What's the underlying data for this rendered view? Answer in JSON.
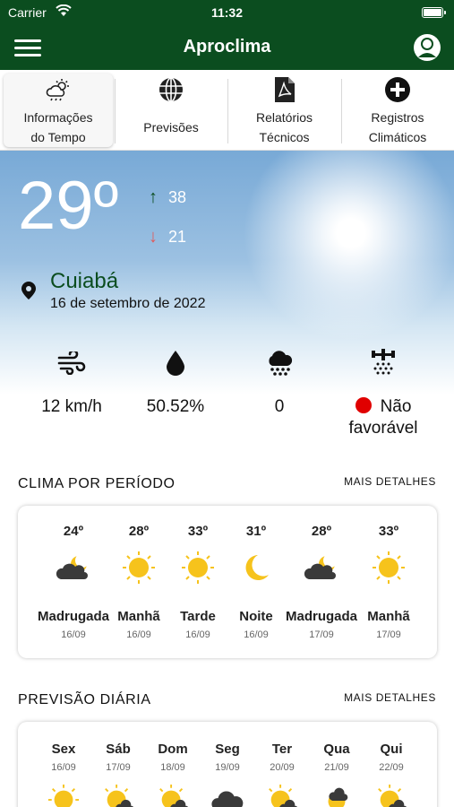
{
  "status_bar": {
    "carrier": "Carrier",
    "time": "11:32"
  },
  "nav": {
    "title": "Aproclima"
  },
  "tabs": [
    {
      "label": "Informações\ndo Tempo",
      "icon": "cloud-sun-icon"
    },
    {
      "label": "Previsões",
      "icon": "globe-icon"
    },
    {
      "label": "Relatórios\nTécnicos",
      "icon": "pdf-file-icon"
    },
    {
      "label": "Registros\nClimáticos",
      "icon": "plus-circle-icon"
    }
  ],
  "current": {
    "temperature": "29º",
    "max": "38",
    "min": "21",
    "city": "Cuiabá",
    "date": "16 de setembro de 2022"
  },
  "metrics": [
    {
      "icon": "wind-icon",
      "value": "12 km/h"
    },
    {
      "icon": "humidity-drop-icon",
      "value": "50.52%"
    },
    {
      "icon": "rain-cloud-icon",
      "value": "0"
    },
    {
      "icon": "sprayer-icon",
      "value_line1": "Não",
      "value_line2": "favorável",
      "status_color": "#e00000"
    }
  ],
  "period_section": {
    "title": "CLIMA POR PERÍODO",
    "link": "MAIS DETALHES"
  },
  "periods": [
    {
      "temp": "24º",
      "label": "Madrugada",
      "date": "16/09",
      "icon": "cloudy-night-icon"
    },
    {
      "temp": "28º",
      "label": "Manhã",
      "date": "16/09",
      "icon": "sun-icon"
    },
    {
      "temp": "33º",
      "label": "Tarde",
      "date": "16/09",
      "icon": "sun-icon"
    },
    {
      "temp": "31º",
      "label": "Noite",
      "date": "16/09",
      "icon": "moon-icon"
    },
    {
      "temp": "28º",
      "label": "Madrugada",
      "date": "17/09",
      "icon": "cloudy-night-icon"
    },
    {
      "temp": "33º",
      "label": "Manhã",
      "date": "17/09",
      "icon": "sun-icon"
    }
  ],
  "daily_section": {
    "title": "PREVISÃO DIÁRIA",
    "link": "MAIS DETALHES"
  },
  "daily": [
    {
      "day": "Sex",
      "date": "16/09",
      "icon": "sun-icon"
    },
    {
      "day": "Sáb",
      "date": "17/09",
      "icon": "partly-cloudy-icon"
    },
    {
      "day": "Dom",
      "date": "18/09",
      "icon": "partly-cloudy-icon"
    },
    {
      "day": "Seg",
      "date": "19/09",
      "icon": "cloud-icon"
    },
    {
      "day": "Ter",
      "date": "20/09",
      "icon": "partly-cloudy-icon"
    },
    {
      "day": "Qua",
      "date": "21/09",
      "icon": "partly-cloudy-icon"
    },
    {
      "day": "Qui",
      "date": "22/09",
      "icon": "partly-cloudy-icon"
    }
  ],
  "colors": {
    "brand_green": "#0b4d1f",
    "max_arrow": "#0b4d1f",
    "min_arrow": "#e05a5a",
    "sun": "#f6c31c",
    "cloud": "#3a3a3a"
  }
}
